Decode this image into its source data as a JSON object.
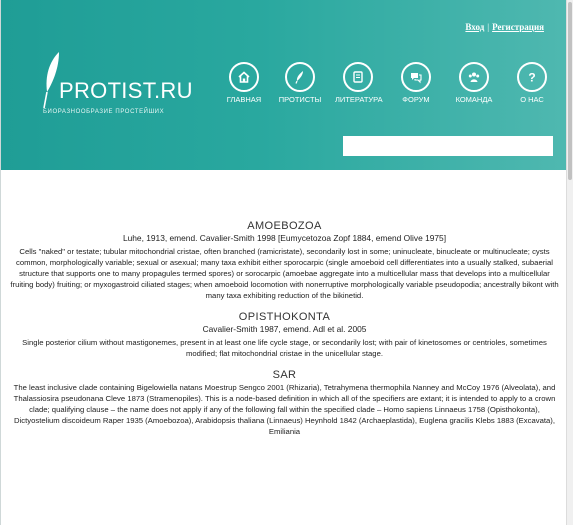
{
  "header": {
    "auth": {
      "login": "Вход",
      "separator": "|",
      "register": "Регистрация"
    },
    "logo": {
      "name": "PROTIST.RU",
      "subtitle": "БИОРАЗНООБРАЗИЕ ПРОСТЕЙШИХ"
    },
    "nav": [
      {
        "label": "ГЛАВНАЯ",
        "icon": "home-icon"
      },
      {
        "label": "ПРОТИСТЫ",
        "icon": "feather-icon"
      },
      {
        "label": "ЛИТЕРАТУРА",
        "icon": "book-icon"
      },
      {
        "label": "ФОРУМ",
        "icon": "chat-icon"
      },
      {
        "label": "КОМАНДА",
        "icon": "team-icon"
      },
      {
        "label": "О НАС",
        "icon": "question-icon"
      }
    ],
    "search_value": ""
  },
  "clades": [
    {
      "name": "AMOEBOZOA",
      "authority": "Luhe, 1913, emend. Cavalier-Smith 1998 [Eumycetozoa Zopf 1884, emend Olive 1975]",
      "description": "Cells \"naked\" or testate; tubular mitochondrial cristae, often branched (ramicristate), secondarily lost in some; uninucleate, binucleate or multinucleate; cysts common, morphologically variable; sexual or asexual; many taxa exhibit either sporocarpic (single amoeboid cell differentiates into a usually stalked, subaerial structure that supports one to many propagules termed spores) or sorocarpic (amoebae aggregate into a multicellular mass that develops into a multicellular fruiting body) fruiting; or myxogastroid ciliated stages; when amoeboid locomotion with nonerruptive morphologically variable pseudopodia; ancestrally bikont with many taxa exhibiting reduction of the bikinetid."
    },
    {
      "name": "OPISTHOKONTA",
      "authority": "Cavalier-Smith 1987, emend. Adl et al. 2005",
      "description": "Single posterior cilium without mastigonemes, present in at least one life cycle stage, or secondarily lost; with pair of kinetosomes or centrioles, sometimes modified; flat mitochondrial cristae in the unicellular stage."
    },
    {
      "name": "SAR",
      "authority": "",
      "description": "The least inclusive clade containing Bigelowiella natans Moestrup Sengco 2001 (Rhizaria), Tetrahymena thermophila Nanney and McCoy 1976 (Alveolata), and Thalassiosira pseudonana Cleve 1873 (Stramenopiles). This is a node-based definition in which all of the specifiers are extant; it is intended to apply to a crown clade; qualifying clause – the name does not apply if any of the following fall within the specified clade – Homo sapiens Linnaeus 1758 (Opisthokonta), Dictyostelium discoideum Raper 1935 (Amoebozoa), Arabidopsis thaliana (Linnaeus) Heynhold 1842 (Archaeplastida), Euglena gracilis Klebs 1883 (Excavata), Emiliania"
    }
  ]
}
